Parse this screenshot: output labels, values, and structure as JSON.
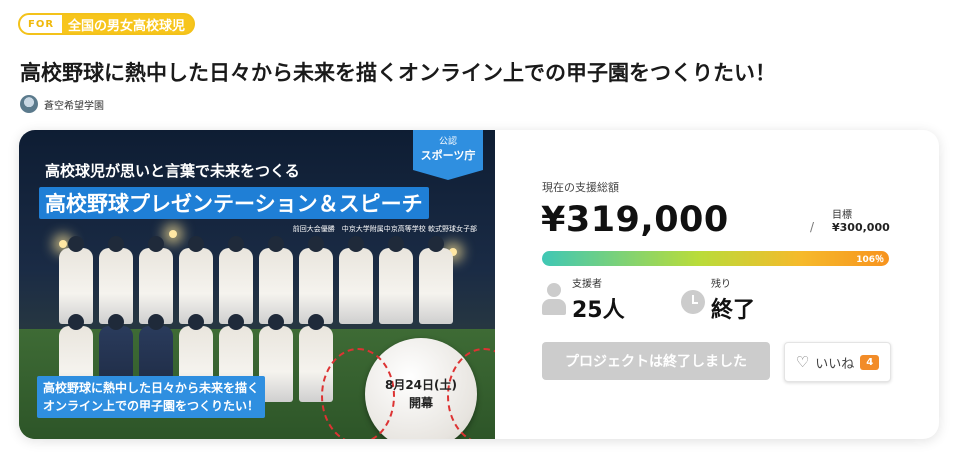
{
  "tag": {
    "prefix": "FOR",
    "category": "全国の男女高校球児"
  },
  "title": "高校野球に熱中した日々から未来を描くオンライン上での甲子園をつくりたい！",
  "owner": {
    "name": "蒼空希望学園"
  },
  "hero": {
    "badge_top": "公認",
    "badge_bottom": "スポーツ庁",
    "catch": "高校球児が思いと言葉で未来をつくる",
    "banner": "高校野球プレゼンテーション＆スピーチ",
    "sub_note": "前回大会優勝　中京大学附属中京高等学校 軟式野球女子部",
    "bottom_note_line1": "高校野球に熱中した日々から未来を描く",
    "bottom_note_line2": "オンライン上での甲子園をつくりたい！",
    "date": "8月24日(土)",
    "date_sub": "開幕"
  },
  "funding": {
    "label": "現在の支援総額",
    "amount": "¥319,000",
    "separator": "/",
    "goal_label": "目標",
    "goal_value": "¥300,000",
    "progress_text": "106％",
    "progress_fraction": 1.06,
    "backers_label": "支援者",
    "backers_value": "25人",
    "remaining_label": "残り",
    "remaining_value": "終了",
    "ended_button": "プロジェクトは終了しました",
    "like_label": "いいね",
    "like_count": "4"
  },
  "colors": {
    "accent": "#f7c51c",
    "blue": "#2f8fe0",
    "like_count": "#f28c28",
    "disabled": "#cccccc"
  },
  "icons": [
    "avatar",
    "person-icon",
    "clock-icon",
    "heart-icon",
    "baseball-icon"
  ]
}
